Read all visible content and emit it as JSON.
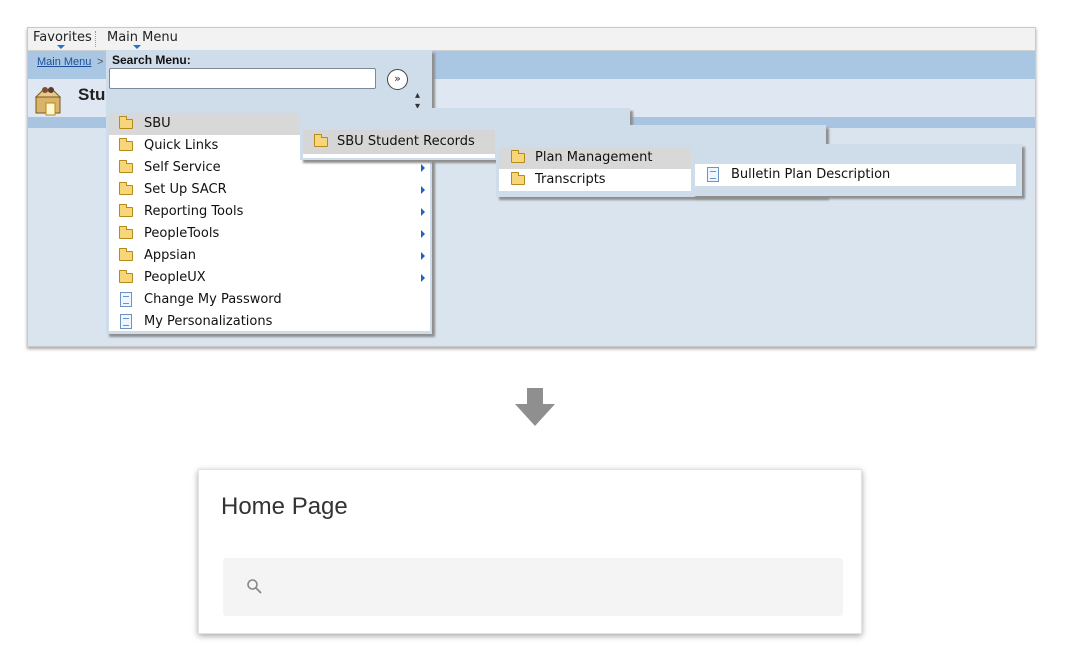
{
  "top_bar": {
    "favorites_label": "Favorites",
    "main_menu_label": "Main Menu"
  },
  "breadcrumb": {
    "link_label": "Main Menu",
    "separator": ">"
  },
  "page_title": "Stu",
  "main_menu": {
    "search_label": "Search Menu:",
    "search_value": "",
    "go_icon": "double-chevron-right-icon",
    "sort_icon": "sort-up-down-icon",
    "items": [
      {
        "label": "SBU",
        "icon": "folder-icon",
        "highlighted": true,
        "has_submenu": false
      },
      {
        "label": "Quick Links",
        "icon": "folder-icon",
        "highlighted": false,
        "has_submenu": true
      },
      {
        "label": "Self Service",
        "icon": "folder-icon",
        "highlighted": false,
        "has_submenu": true
      },
      {
        "label": "Set Up SACR",
        "icon": "folder-icon",
        "highlighted": false,
        "has_submenu": true
      },
      {
        "label": "Reporting Tools",
        "icon": "folder-icon",
        "highlighted": false,
        "has_submenu": true
      },
      {
        "label": "PeopleTools",
        "icon": "folder-icon",
        "highlighted": false,
        "has_submenu": true
      },
      {
        "label": "Appsian",
        "icon": "folder-icon",
        "highlighted": false,
        "has_submenu": true
      },
      {
        "label": "PeopleUX",
        "icon": "folder-icon",
        "highlighted": false,
        "has_submenu": true
      },
      {
        "label": "Change My Password",
        "icon": "document-icon",
        "highlighted": false,
        "has_submenu": false
      },
      {
        "label": "My Personalizations",
        "icon": "document-icon",
        "highlighted": false,
        "has_submenu": false
      }
    ]
  },
  "submenu_sbu": {
    "items": [
      {
        "label": "SBU Student Records",
        "icon": "folder-icon",
        "highlighted": true
      }
    ]
  },
  "submenu_records": {
    "items": [
      {
        "label": "Plan Management",
        "icon": "folder-icon",
        "highlighted": true
      },
      {
        "label": "Transcripts",
        "icon": "folder-icon",
        "highlighted": false
      }
    ]
  },
  "submenu_plan": {
    "items": [
      {
        "label": "Bulletin Plan Description",
        "icon": "document-icon",
        "highlighted": false
      }
    ]
  },
  "home_card": {
    "title": "Home Page",
    "search_value": "",
    "search_icon": "magnifier-icon"
  },
  "colors": {
    "menu_bg": "#cfdcea",
    "highlight": "#d8d8d8",
    "breadcrumb_band": "#a9c6e2",
    "arrow_blue": "#2262c6"
  }
}
